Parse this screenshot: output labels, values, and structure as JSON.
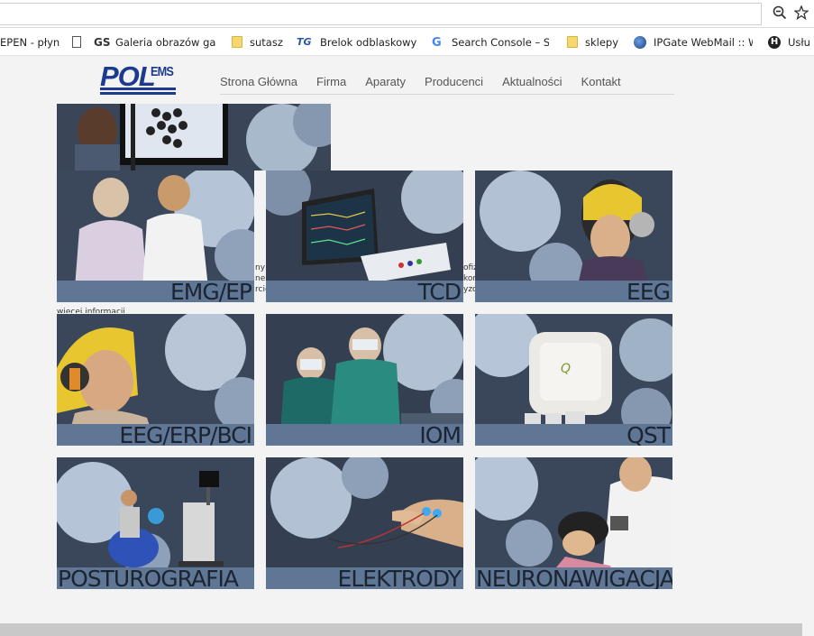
{
  "browser": {
    "bookmarks": [
      {
        "label": "EPEN - płyn",
        "icon": "none"
      },
      {
        "label": "",
        "icon": "page-icon"
      },
      {
        "label": "Galeria obrazów gal",
        "icon": "gs-icon"
      },
      {
        "label": "sutasz",
        "icon": "folder-icon"
      },
      {
        "label": "Brelok odblaskowy N",
        "icon": "tg-icon"
      },
      {
        "label": "Search Console – Str",
        "icon": "google-icon"
      },
      {
        "label": "sklepy",
        "icon": "folder-icon"
      },
      {
        "label": "IPGate WebMail :: W",
        "icon": "globe-icon"
      },
      {
        "label": "Usłu",
        "icon": "dark-icon"
      }
    ],
    "zoom_icon": "zoom-out-icon",
    "star_icon": "star-icon"
  },
  "site": {
    "logo": {
      "main": "POL",
      "suffix": "EMS"
    },
    "nav": [
      "Strona Główna",
      "Firma",
      "Aparaty",
      "Producenci",
      "Aktualności",
      "Kontakt"
    ],
    "background_text": {
      "line1": "ny z",
      "line2": "ne",
      "line3": "rcie",
      "line4": "ofiz",
      "line5": "kon",
      "line6": "yzo",
      "more": "więcej informacji"
    },
    "tiles": [
      {
        "label": "EMG/EP"
      },
      {
        "label": "TCD"
      },
      {
        "label": "EEG"
      },
      {
        "label": "EEG/ERP/BCI"
      },
      {
        "label": "IOM"
      },
      {
        "label": "QST"
      },
      {
        "label": "POSTUROGRAFIA"
      },
      {
        "label": "ELEKTRODY"
      },
      {
        "label": "NEURONAWIGACJA"
      }
    ]
  },
  "colors": {
    "brand_blue": "#1c3b8f",
    "tile_band": "#5f7694",
    "tile_label": "#1b2433"
  }
}
